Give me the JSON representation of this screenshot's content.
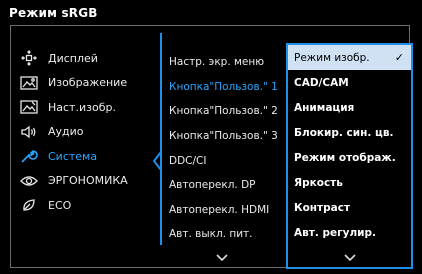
{
  "header": {
    "title": "Режим sRGB"
  },
  "main_menu": {
    "items": [
      {
        "label": "Дисплей",
        "icon": "display-arrows-icon",
        "active": false
      },
      {
        "label": "Изображение",
        "icon": "picture-icon",
        "active": false
      },
      {
        "label": "Наст.изобр.",
        "icon": "advanced-picture-icon",
        "active": false
      },
      {
        "label": "Аудио",
        "icon": "speaker-icon",
        "active": false
      },
      {
        "label": "Система",
        "icon": "wrench-icon",
        "active": true
      },
      {
        "label": "ЭРГОНОМИКА",
        "icon": "eye-icon",
        "active": false
      },
      {
        "label": "ECO",
        "icon": "leaf-icon",
        "active": false
      }
    ]
  },
  "sub_menu": {
    "items": [
      {
        "label": "Настр. экр. меню",
        "active": false
      },
      {
        "label": "Кнопка\"Пользов.\" 1",
        "active": true
      },
      {
        "label": "Кнопка\"Пользов.\" 2",
        "active": false
      },
      {
        "label": "Кнопка\"Пользов.\" 3",
        "active": false
      },
      {
        "label": "DDC/CI",
        "active": false
      },
      {
        "label": "Автоперекл. DP",
        "active": false
      },
      {
        "label": "Автоперекл. HDMI",
        "active": false
      },
      {
        "label": "Авт. выкл. пит.",
        "active": false
      }
    ]
  },
  "options": {
    "items": [
      {
        "label": "Режим изобр.",
        "selected": true
      },
      {
        "label": "CAD/CAM",
        "selected": false
      },
      {
        "label": "Анимация",
        "selected": false
      },
      {
        "label": "Блокир. син. цв.",
        "selected": false
      },
      {
        "label": "Режим отображ.",
        "selected": false
      },
      {
        "label": "Яркость",
        "selected": false
      },
      {
        "label": "Контраст",
        "selected": false
      },
      {
        "label": "Авт. регулир.",
        "selected": false
      }
    ],
    "checkmark": "✓"
  },
  "colors": {
    "accent": "#2aa6ff",
    "frame": "#1f8fe8",
    "selected_bg": "#cfe1f2"
  }
}
